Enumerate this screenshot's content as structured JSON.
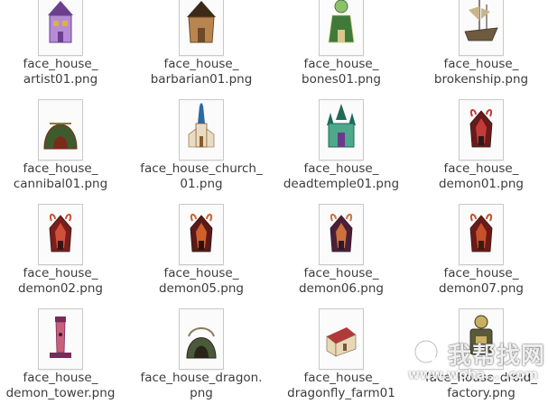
{
  "files": [
    {
      "line1": "face_house_",
      "line2": "artist01.png",
      "icon": "house-artist-thumbnail",
      "palette": [
        "#6b3f8e",
        "#b58cd6",
        "#d9b24a"
      ]
    },
    {
      "line1": "face_house_",
      "line2": "barbarian01.png",
      "icon": "house-barbarian-thumbnail",
      "palette": [
        "#6e4a2a",
        "#b9854e",
        "#3c2a18"
      ]
    },
    {
      "line1": "face_house_",
      "line2": "bones01.png",
      "icon": "house-bones-thumbnail",
      "palette": [
        "#3f7a3a",
        "#8ec06a",
        "#d9c88a"
      ]
    },
    {
      "line1": "face_house_",
      "line2": "brokenship.png",
      "icon": "house-brokenship-thumbnail",
      "palette": [
        "#6e5a3e",
        "#c9b48a",
        "#3b3024"
      ]
    },
    {
      "line1": "face_house_",
      "line2": "cannibal01.png",
      "icon": "house-cannibal-thumbnail",
      "palette": [
        "#3f5a2c",
        "#8a7a3e",
        "#7b2a1c"
      ]
    },
    {
      "line1": "face_house_church_",
      "line2": "01.png",
      "icon": "house-church-thumbnail",
      "palette": [
        "#2a6aa6",
        "#e8dcc4",
        "#8a5a2a"
      ]
    },
    {
      "line1": "face_house_",
      "line2": "deadtemple01.png",
      "icon": "house-deadtemple-thumbnail",
      "palette": [
        "#1f6a5a",
        "#4ea88a",
        "#6a3a8a"
      ]
    },
    {
      "line1": "face_house_",
      "line2": "demon01.png",
      "icon": "house-demon-thumbnail",
      "palette": [
        "#6a1a1a",
        "#c43a3a",
        "#2a1a1a"
      ]
    },
    {
      "line1": "face_house_",
      "line2": "demon02.png",
      "icon": "house-demon-thumbnail",
      "palette": [
        "#7a1e1e",
        "#d0503a",
        "#3a1414"
      ]
    },
    {
      "line1": "face_house_",
      "line2": "demon05.png",
      "icon": "house-demon-thumbnail",
      "palette": [
        "#5a1a1a",
        "#d0602a",
        "#2a1010"
      ]
    },
    {
      "line1": "face_house_",
      "line2": "demon06.png",
      "icon": "house-demon-thumbnail",
      "palette": [
        "#4a1f3a",
        "#d0703a",
        "#2a1a2a"
      ]
    },
    {
      "line1": "face_house_",
      "line2": "demon07.png",
      "icon": "house-demon-thumbnail",
      "palette": [
        "#6a1a1a",
        "#c8502a",
        "#3a1a10"
      ]
    },
    {
      "line1": "face_house_",
      "line2": "demon_tower.png",
      "icon": "house-demon-tower-thumbnail",
      "palette": [
        "#7a2a5a",
        "#c8607a",
        "#3a1a2a"
      ]
    },
    {
      "line1": "face_house_dragon.",
      "line2": "png",
      "icon": "house-dragon-thumbnail",
      "palette": [
        "#4a5a3a",
        "#8a7a5a",
        "#2a2418"
      ]
    },
    {
      "line1": "face_house_",
      "line2": "dragonfly_farm01",
      "icon": "house-dragonfly-farm-thumbnail",
      "palette": [
        "#b03a3a",
        "#e8d8b8",
        "#7a5a3a"
      ]
    },
    {
      "line1": "face_house_droid_",
      "line2": "factory.png",
      "icon": "house-droid-factory-thumbnail",
      "palette": [
        "#5a5a3a",
        "#c8b060",
        "#3a3424"
      ]
    }
  ],
  "watermark": {
    "text_cn": "我帮找网",
    "text_en": "www.woha... .com"
  }
}
